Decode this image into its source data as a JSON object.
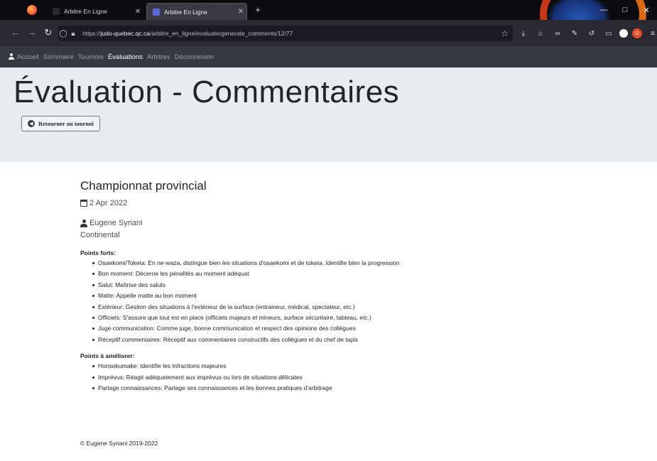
{
  "browser": {
    "tabs": [
      {
        "title": "Arbitre En Ligne",
        "active": false
      },
      {
        "title": "Arbitre En Ligne",
        "active": true
      }
    ],
    "new_tab": "+",
    "url_prefix": "https://",
    "url_domain": "judo-quebec.qc.ca",
    "url_path": "/arbitre_en_ligne/evaluate/generate_comments/12/77",
    "window_controls": {
      "minimize": "—",
      "maximize": "□",
      "close": "✕"
    }
  },
  "site_nav": {
    "items": [
      {
        "label": "Accueil",
        "active": false,
        "icon": "user-icon"
      },
      {
        "label": "Sommaire",
        "active": false
      },
      {
        "label": "Tournois",
        "active": false
      },
      {
        "label": "Évaluations",
        "active": true
      },
      {
        "label": "Arbitres",
        "active": false
      },
      {
        "label": "Déconnexion",
        "active": false
      }
    ]
  },
  "header": {
    "title": "Évaluation - Commentaires",
    "back_button": "Retourner au tournoi"
  },
  "main": {
    "tournament": "Championnat provincial",
    "date": "2 Apr 2022",
    "referee_name": "Eugene Syriani",
    "referee_level": "Continental",
    "strengths_heading": "Points forts:",
    "strengths": [
      "Osaekomi/Toketa: En ne-waza, distingue bien les situations d'osaekomi et de toketa. Identifie bien la progression",
      "Bon moment: Décerne les pénalités au moment adéquat",
      "Salut: Maîtrise des saluts",
      "Matte: Appelle matte au bon moment",
      "Extérieur: Gestion des situations à l'extérieur de la surface (entraineur, médical, spectateur, etc.)",
      "Officiels: S'assure que tout est en place (officiels majeurs et mineurs, surface sécuritaire, tableau, etc.)",
      "Juge communication: Comme juge, bonne communication et respect des opinions des collègues",
      "Réceptif commentaires: Réceptif aux commentaires constructifs des collègues et du chef de tapis"
    ],
    "improve_heading": "Points à améliorer:",
    "improvements": [
      "Honsokumake: Identifie les infractions majeures",
      "Imprévus: Réagit adéquatement aux imprévus ou lors de situations délicates",
      "Partage connaissances: Partage ses connaissances et les bonnes pratiques d'arbitrage"
    ]
  },
  "footer": {
    "copyright": "© Eugene Syriani 2019-2022"
  }
}
